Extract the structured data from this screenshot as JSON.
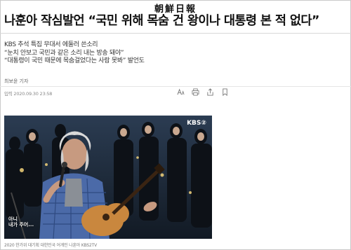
{
  "masthead": {
    "name": "朝鮮日報"
  },
  "article": {
    "headline": "나훈아 작심발언 “국민 위해 목숨 건 왕이나 대통령 본 적 없다”",
    "subheads": [
      "KBS 추석 특집 무대서 에둘러 쓴소리",
      "“눈치 안보고 국민과 같은 소리 내는 방송 돼야”",
      "“대통령이 국민 때문에 목숨걸었다는 사람 못봐” 발언도"
    ],
    "byline": "최보윤 기자",
    "dateline": "입력 2020.09.30 23:58"
  },
  "toolbar": {
    "icons": [
      "font-size-icon",
      "print-icon",
      "share-icon",
      "bookmark-icon"
    ]
  },
  "photo": {
    "broadcaster_logo": "KBS②",
    "onscreen_subtitle": [
      "아니",
      "내가 주어..."
    ],
    "caption": "2020 한가위 대기획 대한민국 어게인 나훈아 KBS2TV"
  },
  "colors": {
    "stage_bg": "#1c2a38",
    "shirt": "#4b6aa8",
    "guitar": "#c9873e"
  }
}
